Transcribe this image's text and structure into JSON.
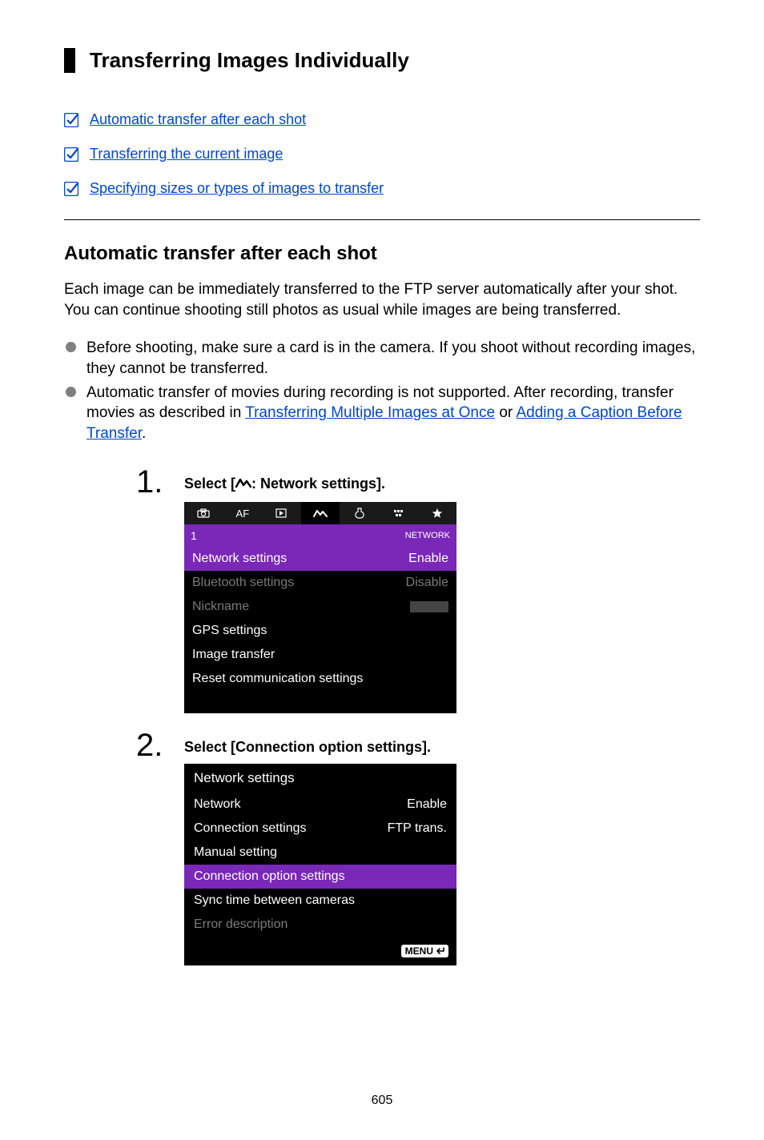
{
  "title": "Transferring Images Individually",
  "toc": {
    "items": [
      "Automatic transfer after each shot",
      "Transferring the current image",
      "Specifying sizes or types of images to transfer"
    ]
  },
  "section": {
    "heading": "Automatic transfer after each shot",
    "intro": "Each image can be immediately transferred to the FTP server automatically after your shot. You can continue shooting still photos as usual while images are being transferred.",
    "bullets": [
      {
        "text": "Before shooting, make sure a card is in the camera. If you shoot without recording images, they cannot be transferred."
      },
      {
        "prefix": "Automatic transfer of movies during recording is not supported. After recording, transfer movies as described in ",
        "link1": "Transferring Multiple Images at Once",
        "middle": " or ",
        "link2": "Adding a Caption Before Transfer",
        "suffix": "."
      }
    ]
  },
  "steps": {
    "s1": {
      "num": "1.",
      "prefix": "Select [",
      "suffix": ": Network settings].",
      "cam": {
        "tabs": [
          "camera",
          "AF",
          "play",
          "network",
          "wrench",
          "level",
          "star"
        ],
        "page": "1",
        "pageLabel": "NETWORK",
        "rows": [
          {
            "label": "Network settings",
            "value": "Enable",
            "sel": true
          },
          {
            "label": "Bluetooth settings",
            "value": "Disable",
            "dim": true
          },
          {
            "label": "Nickname",
            "value": "",
            "dim": true,
            "nick": true
          },
          {
            "label": "GPS settings",
            "value": ""
          },
          {
            "label": "Image transfer",
            "value": ""
          },
          {
            "label": "Reset communication settings",
            "value": ""
          }
        ]
      }
    },
    "s2": {
      "num": "2.",
      "text": "Select [Connection option settings].",
      "cam": {
        "title": "Network settings",
        "rows": [
          {
            "label": "Network",
            "value": "Enable"
          },
          {
            "label": "Connection settings",
            "value": "FTP trans."
          },
          {
            "label": "Manual setting",
            "value": ""
          },
          {
            "label": "Connection option settings",
            "value": "",
            "sel": true
          },
          {
            "label": "Sync time between cameras",
            "value": ""
          },
          {
            "label": "Error description",
            "value": "",
            "dim": true
          }
        ],
        "menu": "MENU"
      }
    }
  },
  "pageNumber": "605"
}
